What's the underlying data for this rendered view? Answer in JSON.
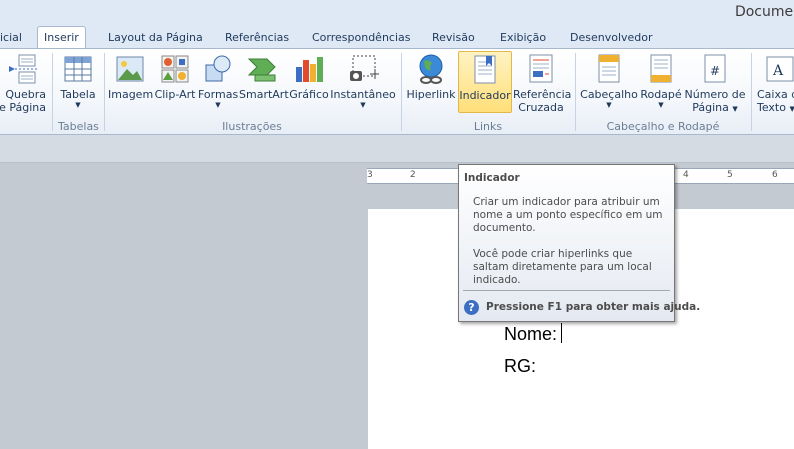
{
  "window": {
    "title": "Documen"
  },
  "tabs": [
    {
      "label": "icial"
    },
    {
      "label": "Inserir"
    },
    {
      "label": "Layout da Página"
    },
    {
      "label": "Referências"
    },
    {
      "label": "Correspondências"
    },
    {
      "label": "Revisão"
    },
    {
      "label": "Exibição"
    },
    {
      "label": "Desenvolvedor"
    }
  ],
  "ribbon": {
    "quebra": {
      "line1": "Quebra",
      "line2": "e Página"
    },
    "tabela": {
      "label": "Tabela"
    },
    "imagem": {
      "label": "Imagem"
    },
    "clipart": {
      "label": "Clip-Art"
    },
    "formas": {
      "label": "Formas"
    },
    "smartart": {
      "label": "SmartArt"
    },
    "grafico": {
      "label": "Gráfico"
    },
    "instantaneo": {
      "label": "Instantâneo"
    },
    "hiperlink": {
      "label": "Hiperlink"
    },
    "indicador": {
      "label": "Indicador"
    },
    "refcruzada": {
      "line1": "Referência",
      "line2": "Cruzada"
    },
    "cabecalho": {
      "label": "Cabeçalho"
    },
    "rodape": {
      "label": "Rodapé"
    },
    "numpagina": {
      "line1": "Número de",
      "line2": "Página"
    },
    "caixatexto": {
      "line1": "Caixa d",
      "line2": "Texto"
    },
    "groups": {
      "tabelas": "Tabelas",
      "ilustracoes": "Ilustrações",
      "links": "Links",
      "cabrodape": "Cabeçalho e Rodapé"
    }
  },
  "ruler": {
    "marks": [
      "3",
      "2",
      "4",
      "5",
      "6"
    ]
  },
  "document": {
    "nome_label": "Nome:",
    "rg_label": "RG:"
  },
  "tooltip": {
    "title": "Indicador",
    "p1": "Criar um indicador para atribuir um nome a um ponto específico em um documento.",
    "p2": "Você pode criar hiperlinks que saltam diretamente para um local indicado.",
    "help": "Pressione F1 para obter mais ajuda."
  },
  "colors": {
    "accent": "#1e395b",
    "highlight": "#ffdf7a",
    "ribbon_bg": "#dfe9f5"
  }
}
